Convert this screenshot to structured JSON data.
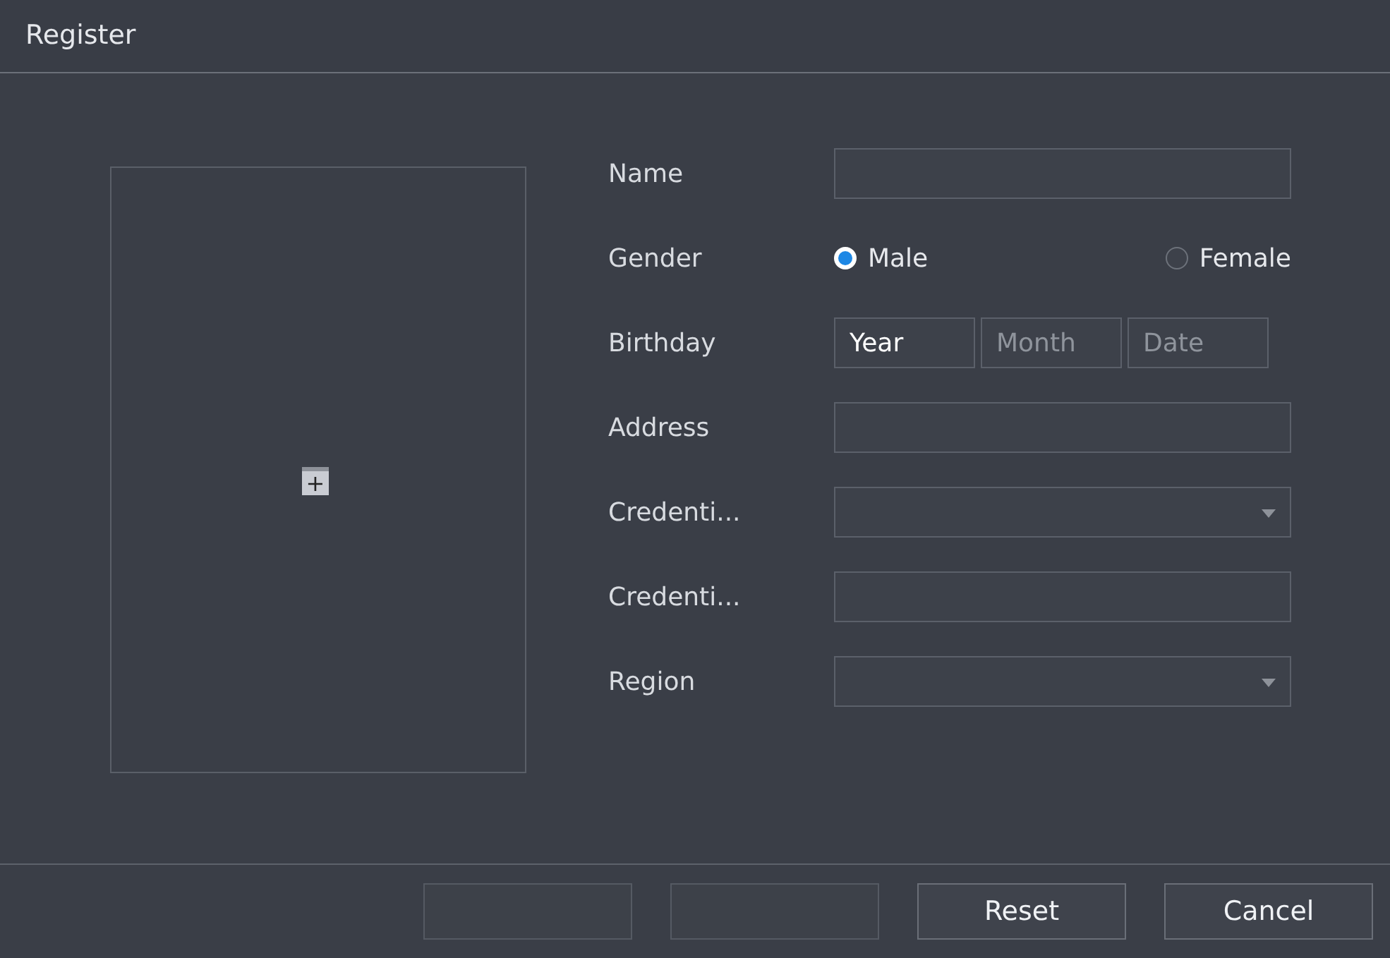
{
  "window": {
    "title": "Register"
  },
  "photo_slot": {
    "add_icon": "+"
  },
  "form": [
    {
      "kind": "text",
      "label": "Name"
    },
    {
      "kind": "radio",
      "label": "Gender",
      "options": [
        {
          "label": "Male",
          "selected": true
        },
        {
          "label": "Female",
          "selected": false
        }
      ]
    },
    {
      "kind": "date",
      "label": "Birthday",
      "parts": [
        {
          "placeholder": "Year",
          "disabled": false
        },
        {
          "placeholder": "Month",
          "disabled": true
        },
        {
          "placeholder": "Date",
          "disabled": true
        }
      ]
    },
    {
      "kind": "text",
      "label": "Address"
    },
    {
      "kind": "select",
      "label": "Credenti..."
    },
    {
      "kind": "text",
      "label": "Credenti..."
    },
    {
      "kind": "select",
      "label": "Region"
    }
  ],
  "buttons": [
    {
      "disabled": true
    },
    {
      "disabled": true
    },
    {
      "label": "Reset",
      "disabled": false
    },
    {
      "label": "Cancel",
      "disabled": false
    }
  ]
}
